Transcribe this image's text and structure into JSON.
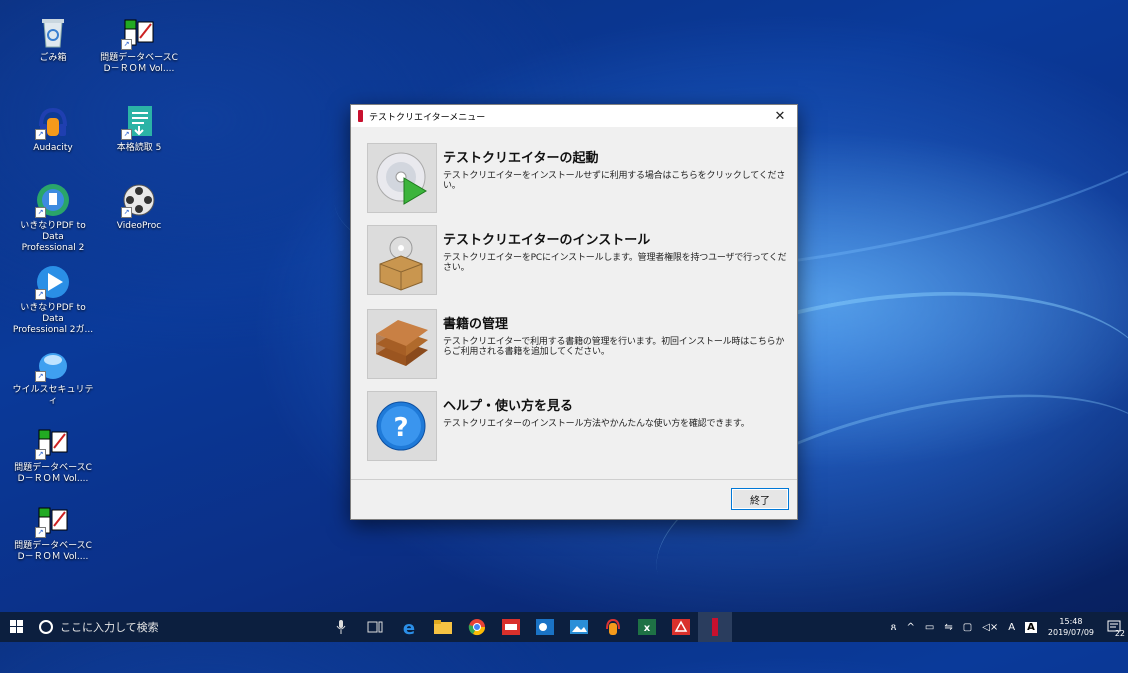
{
  "desktop": {
    "icons": [
      {
        "label": "ごみ箱"
      },
      {
        "label": "問題データベースC\nD－ＲＯＭ Vol...."
      },
      {
        "label": "Audacity"
      },
      {
        "label": "本格読取 5"
      },
      {
        "label": "いきなりPDF to Data\nProfessional 2"
      },
      {
        "label": "VideoProc"
      },
      {
        "label": "いきなりPDF to Data\nProfessional 2ガ..."
      },
      {
        "label": "ウイルスセキュリティ"
      },
      {
        "label": "問題データベースC\nD－ＲＯＭ Vol...."
      },
      {
        "label": "問題データベースC\nD－ＲＯＭ Vol...."
      }
    ]
  },
  "dialog": {
    "title": "テストクリエイターメニュー",
    "close": "✕",
    "items": [
      {
        "title": "テストクリエイターの起動",
        "desc": "テストクリエイターをインストールせずに利用する場合はこちらをクリックしてください。",
        "icon": "cd-play-icon"
      },
      {
        "title": "テストクリエイターのインストール",
        "desc": "テストクリエイターをPCにインストールします。管理者権限を持つユーザで行ってください。",
        "icon": "install-box-icon"
      },
      {
        "title": "書籍の管理",
        "desc": "テストクリエイターで利用する書籍の管理を行います。初回インストール時はこちらからご利用される書籍を追加してください。",
        "icon": "books-icon"
      },
      {
        "title": "ヘルプ・使い方を見る",
        "desc": "テストクリエイターのインストール方法やかんたんな使い方を確認できます。",
        "icon": "help-icon"
      }
    ],
    "exit_label": "終了"
  },
  "taskbar": {
    "search_placeholder": "ここに入力して検索",
    "clock_time": "15:48",
    "clock_date": "2019/07/09",
    "ime": "A",
    "notification_count": "22"
  },
  "colors": {
    "accent": "#0078d7",
    "taskbar": "#0c1f3f",
    "brand_red": "#c8102e"
  }
}
